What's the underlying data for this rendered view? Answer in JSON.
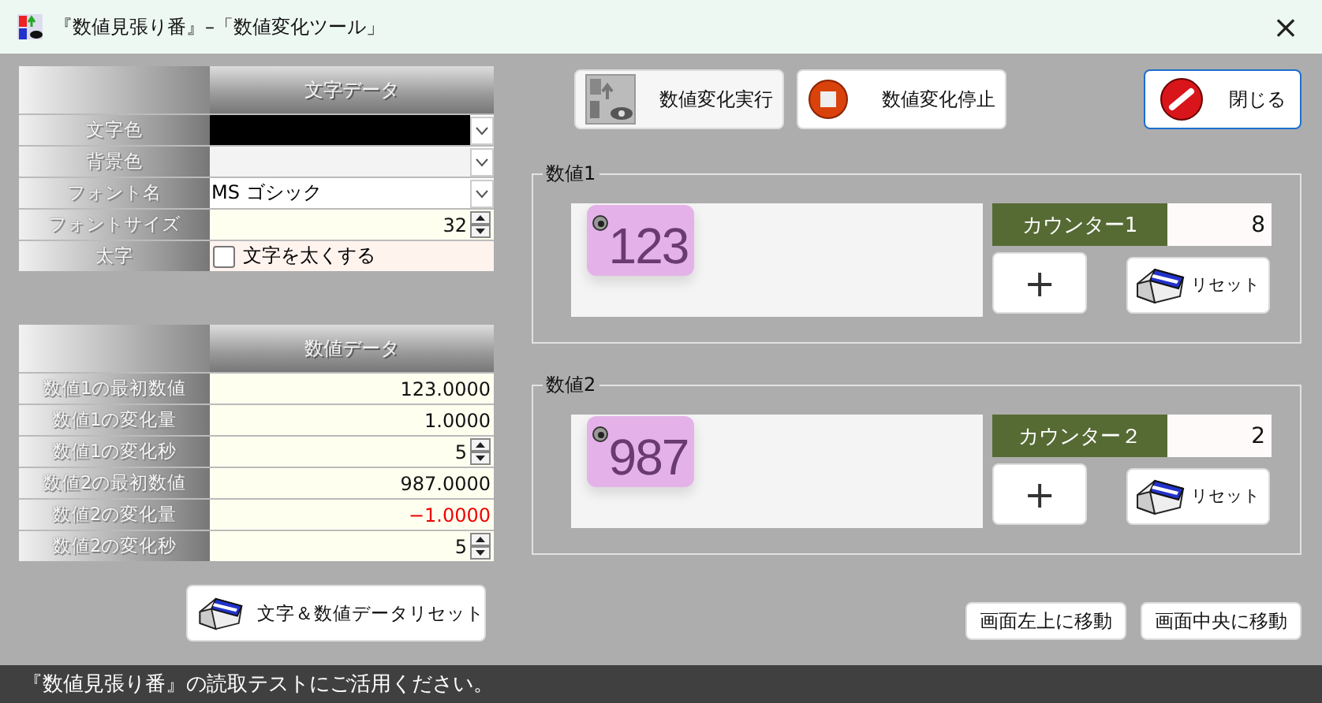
{
  "window": {
    "title": "『数値見張り番』–「数値変化ツール」",
    "close": "×"
  },
  "text_table": {
    "header": "文字データ",
    "rows": [
      {
        "kind": "color",
        "label": "文字色",
        "color": "#000000"
      },
      {
        "kind": "color",
        "label": "背景色",
        "color": "#f3f3f3"
      },
      {
        "kind": "select",
        "label": "フォント名",
        "value": "MS ゴシック"
      },
      {
        "kind": "spin",
        "label": "フォントサイズ",
        "value": "32"
      },
      {
        "kind": "checkbox",
        "label": "太字",
        "text": "文字を太くする",
        "checked": false
      }
    ]
  },
  "number_table": {
    "header": "数値データ",
    "rows": [
      {
        "kind": "number",
        "label": "数値1の最初数値",
        "value": "123.0000",
        "warning": false
      },
      {
        "kind": "number",
        "label": "数値1の変化量",
        "value": "1.0000",
        "warning": false
      },
      {
        "kind": "spin",
        "label": "数値1の変化秒",
        "value": "5",
        "warning": false
      },
      {
        "kind": "number",
        "label": "数値2の最初数値",
        "value": "987.0000",
        "warning": false
      },
      {
        "kind": "number",
        "label": "数値2の変化量",
        "value": "−1.0000",
        "warning": true
      },
      {
        "kind": "spin",
        "label": "数値2の変化秒",
        "value": "5",
        "warning": false
      }
    ]
  },
  "reset_all_button": "文字＆数値データリセット",
  "toolbar": {
    "run_button": "数値変化実行",
    "stop_button": "数値変化停止",
    "close_button": "閉じる"
  },
  "groups": [
    {
      "title": "数値1",
      "display": "123",
      "counter_label": "カウンター1",
      "counter_value": "8",
      "plus": "+",
      "reset": "リセット"
    },
    {
      "title": "数値2",
      "display": "987",
      "counter_label": "カウンター２",
      "counter_value": "2",
      "plus": "+",
      "reset": "リセット"
    }
  ],
  "move_buttons": [
    "画面左上に移動",
    "画面中央に移動"
  ],
  "status_bar": "『数値見張り番』の読取テストにご活用ください。"
}
